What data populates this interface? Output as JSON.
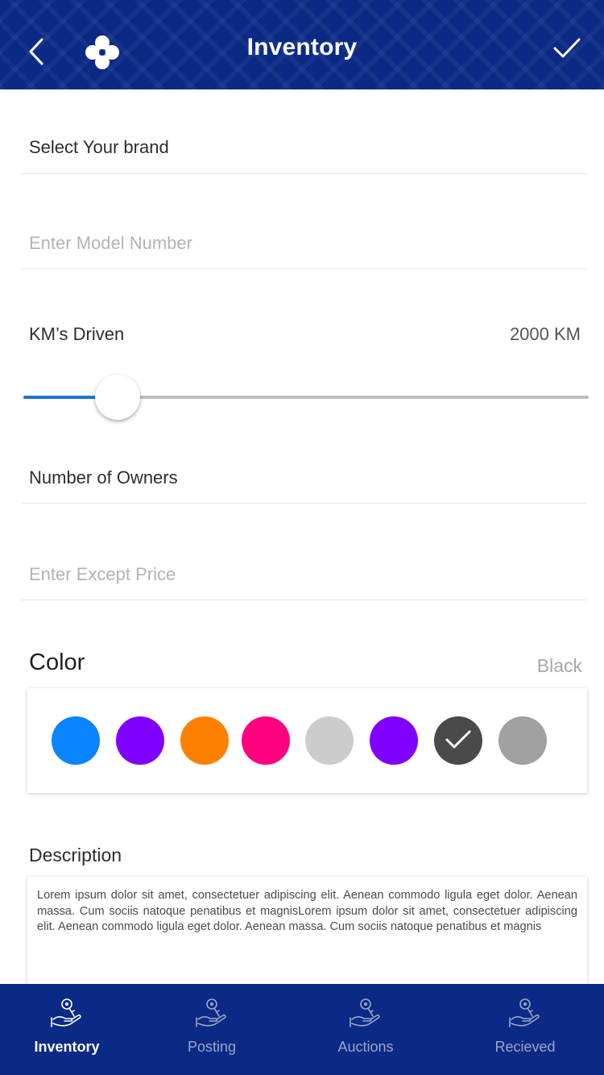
{
  "header": {
    "title": "Inventory",
    "back_icon": "chevron-left-icon",
    "logo_icon": "clover-logo-icon",
    "confirm_icon": "check-icon"
  },
  "form": {
    "brand_label": "Select Your brand",
    "model_placeholder": "Enter Model Number",
    "km": {
      "label": "KM’s Driven",
      "value_text": "2000 KM",
      "slider_fraction": 0.167
    },
    "owners_label": "Number of Owners",
    "price_placeholder": "Enter Except Price",
    "color": {
      "title": "Color",
      "selected_name": "Black",
      "swatches": [
        "#0a84ff",
        "#8000ff",
        "#ff8000",
        "#ff007f",
        "#cccccc",
        "#8000ff",
        "#4a4a4a",
        "#a0a0a0"
      ],
      "selected_index": 6
    },
    "description": {
      "title": "Description",
      "text": "Lorem ipsum dolor sit amet, consectetuer adipiscing elit. Aenean commodo ligula eget dolor. Aenean massa. Cum sociis natoque penatibus et magnisLorem ipsum dolor sit amet, consectetuer adipiscing elit. Aenean commodo ligula eget dolor. Aenean massa. Cum sociis natoque penatibus et magnis"
    }
  },
  "bottom_nav": {
    "items": [
      {
        "label": "Inventory",
        "icon": "hand-key-icon",
        "active": true
      },
      {
        "label": "Posting",
        "icon": "hand-key-icon",
        "active": false
      },
      {
        "label": "Auctions",
        "icon": "hand-key-icon",
        "active": false
      },
      {
        "label": "Recieved",
        "icon": "hand-key-icon",
        "active": false
      }
    ]
  },
  "colors": {
    "primary": "#0b2a85",
    "slider_active": "#1976d2"
  }
}
